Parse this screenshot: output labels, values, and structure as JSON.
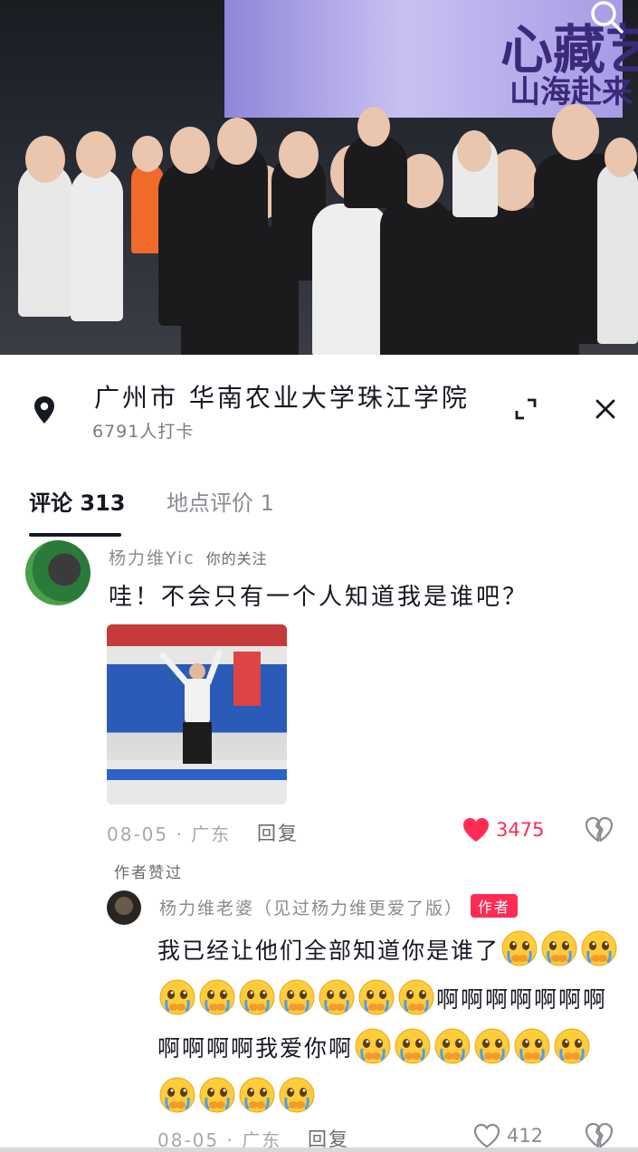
{
  "video": {
    "banner_line1": "心藏艺未",
    "banner_line2": "山海赴来"
  },
  "location": {
    "title": "广州市 华南农业大学珠江学院",
    "checkins": "6791人打卡"
  },
  "tabs": [
    {
      "label": "评论 313"
    },
    {
      "label": "地点评价 1"
    }
  ],
  "comment": {
    "author": "杨力维Yic",
    "tag": "你的关注",
    "text": "哇！不会只有一个人知道我是谁吧？",
    "meta": "08-05 · 广东",
    "reply_label": "回复",
    "likes": "3475",
    "author_liked": "作者赞过"
  },
  "reply": {
    "author": "杨力维老婆（见过杨力维更爱了版）",
    "badge": "作者",
    "text_part1": "我已经让他们全部知道你是谁了",
    "text_part2": "啊啊啊啊啊啊啊啊啊啊啊我爱你啊",
    "meta": "08-05 · 广东",
    "reply_label": "回复",
    "likes": "412"
  },
  "colors": {
    "accent": "#fe2c55",
    "text": "#161823",
    "muted": "#8a8b91"
  },
  "icons": [
    "search-icon",
    "location-pin-icon",
    "expand-icon",
    "close-icon",
    "heart-filled-icon",
    "heart-outline-icon",
    "broken-heart-icon",
    "crying-emoji-icon"
  ]
}
